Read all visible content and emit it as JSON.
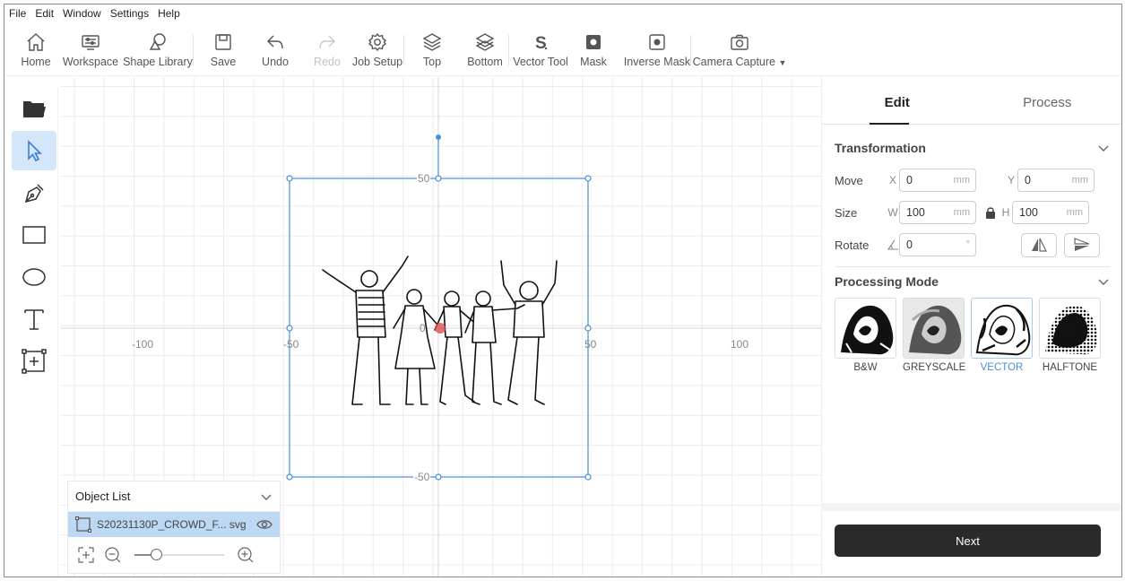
{
  "menu": [
    "File",
    "Edit",
    "Window",
    "Settings",
    "Help"
  ],
  "toolbar": {
    "home": "Home",
    "workspace": "Workspace",
    "shape_library": "Shape Library",
    "save": "Save",
    "undo": "Undo",
    "redo": "Redo",
    "job_setup": "Job Setup",
    "top": "Top",
    "bottom": "Bottom",
    "vector_tool": "Vector Tool",
    "mask": "Mask",
    "inverse_mask": "Inverse Mask",
    "camera_capture": "Camera Capture"
  },
  "canvas": {
    "x_labels": [
      "-100",
      "-50",
      "0",
      "50",
      "100"
    ],
    "y_labels": [
      "50",
      "-50"
    ]
  },
  "object_list": {
    "title": "Object List",
    "items": [
      {
        "name": "S20231130P_CROWD_F... svg"
      }
    ]
  },
  "zoom": {
    "level_fraction": 0.24
  },
  "panel": {
    "tabs": [
      "Edit",
      "Process"
    ],
    "transformation": {
      "title": "Transformation",
      "move_label": "Move",
      "x_axis": "X",
      "x_value": "0",
      "y_axis": "Y",
      "y_value": "0",
      "size_label": "Size",
      "w_axis": "W",
      "w_value": "100",
      "h_axis": "H",
      "h_value": "100",
      "rotate_label": "Rotate",
      "rotate_value": "0",
      "unit": "mm",
      "deg": "°"
    },
    "processing_mode": {
      "title": "Processing Mode",
      "modes": [
        "B&W",
        "GREYSCALE",
        "VECTOR",
        "HALFTONE"
      ],
      "selected": "VECTOR"
    },
    "next_label": "Next"
  },
  "colors": {
    "accent": "#4a8fd9",
    "selection": "#bcd8f2",
    "next_bg": "#2a2a2a"
  }
}
